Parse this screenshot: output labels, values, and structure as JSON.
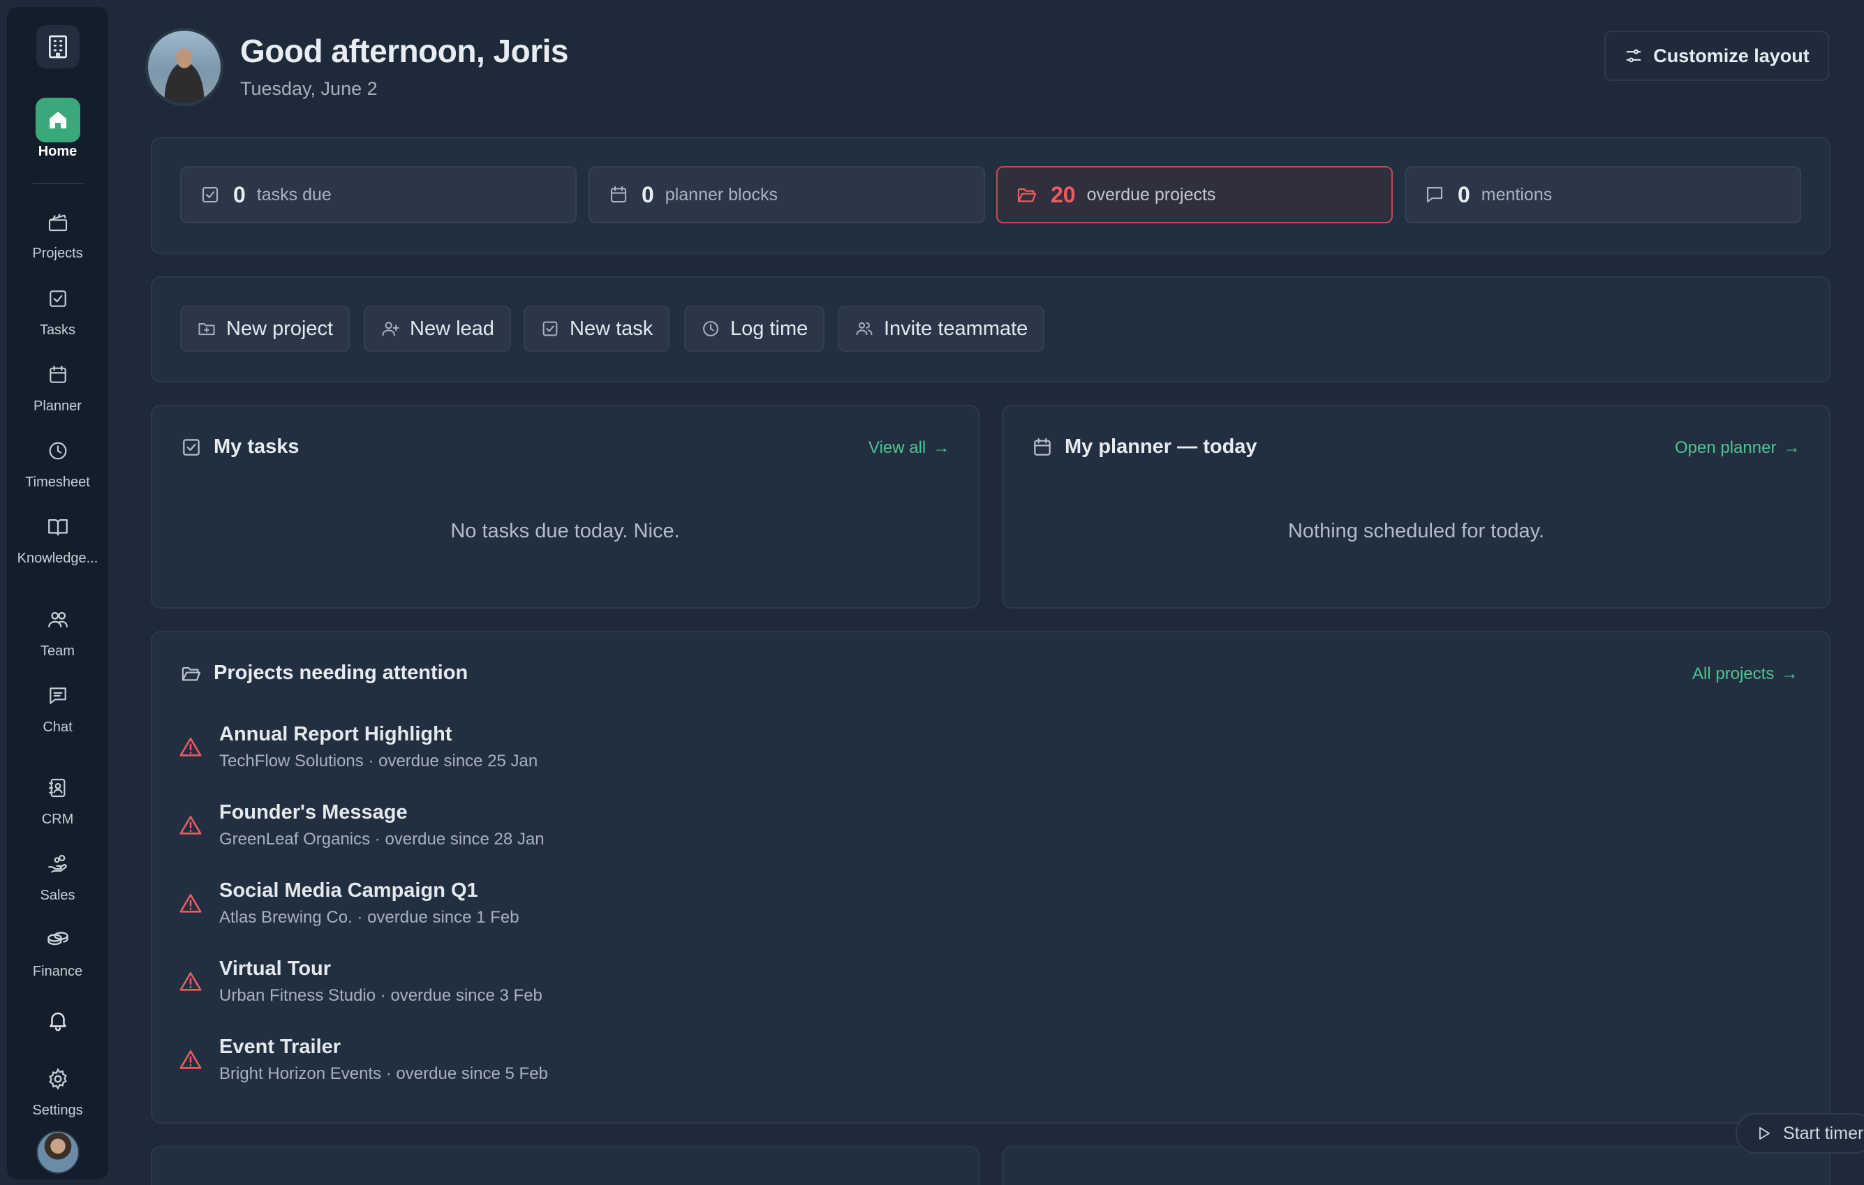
{
  "sidebar": {
    "items": [
      {
        "label": "Home",
        "icon": "home-icon"
      },
      {
        "label": "Projects",
        "icon": "clapperboard-icon"
      },
      {
        "label": "Tasks",
        "icon": "checkbox-icon"
      },
      {
        "label": "Planner",
        "icon": "calendar-icon"
      },
      {
        "label": "Timesheet",
        "icon": "clock-icon"
      },
      {
        "label": "Knowledge...",
        "icon": "book-icon"
      },
      {
        "label": "Team",
        "icon": "users-icon"
      },
      {
        "label": "Chat",
        "icon": "message-icon"
      },
      {
        "label": "CRM",
        "icon": "contact-book-icon"
      },
      {
        "label": "Sales",
        "icon": "hand-coins-icon"
      },
      {
        "label": "Finance",
        "icon": "coins-icon"
      },
      {
        "label": "",
        "icon": "bell-icon"
      },
      {
        "label": "Settings",
        "icon": "gear-icon"
      }
    ]
  },
  "header": {
    "greeting": "Good afternoon, Joris",
    "date": "Tuesday, June 2",
    "customize_label": "Customize layout"
  },
  "stats": [
    {
      "value": "0",
      "label": "tasks due"
    },
    {
      "value": "0",
      "label": "planner blocks"
    },
    {
      "value": "20",
      "label": "overdue projects"
    },
    {
      "value": "0",
      "label": "mentions"
    }
  ],
  "actions": [
    {
      "label": "New project"
    },
    {
      "label": "New lead"
    },
    {
      "label": "New task"
    },
    {
      "label": "Log time"
    },
    {
      "label": "Invite teammate"
    }
  ],
  "my_tasks": {
    "title": "My tasks",
    "link": "View all",
    "empty": "No tasks due today. Nice."
  },
  "planner": {
    "title": "My planner — today",
    "link": "Open planner",
    "empty": "Nothing scheduled for today."
  },
  "projects": {
    "title": "Projects needing attention",
    "link": "All projects",
    "items": [
      {
        "name": "Annual Report Highlight",
        "meta": "TechFlow Solutions · overdue since 25 Jan"
      },
      {
        "name": "Founder's Message",
        "meta": "GreenLeaf Organics · overdue since 28 Jan"
      },
      {
        "name": "Social Media Campaign Q1",
        "meta": "Atlas Brewing Co. · overdue since 1 Feb"
      },
      {
        "name": "Virtual Tour",
        "meta": "Urban Fitness Studio · overdue since 3 Feb"
      },
      {
        "name": "Event Trailer",
        "meta": "Bright Horizon Events · overdue since 5 Feb"
      }
    ]
  },
  "timer": {
    "label": "Start timer"
  },
  "colors": {
    "accent": "#3aa878",
    "link": "#4fc48f",
    "danger": "#ee5b5f",
    "background": "#1e2a3a"
  }
}
